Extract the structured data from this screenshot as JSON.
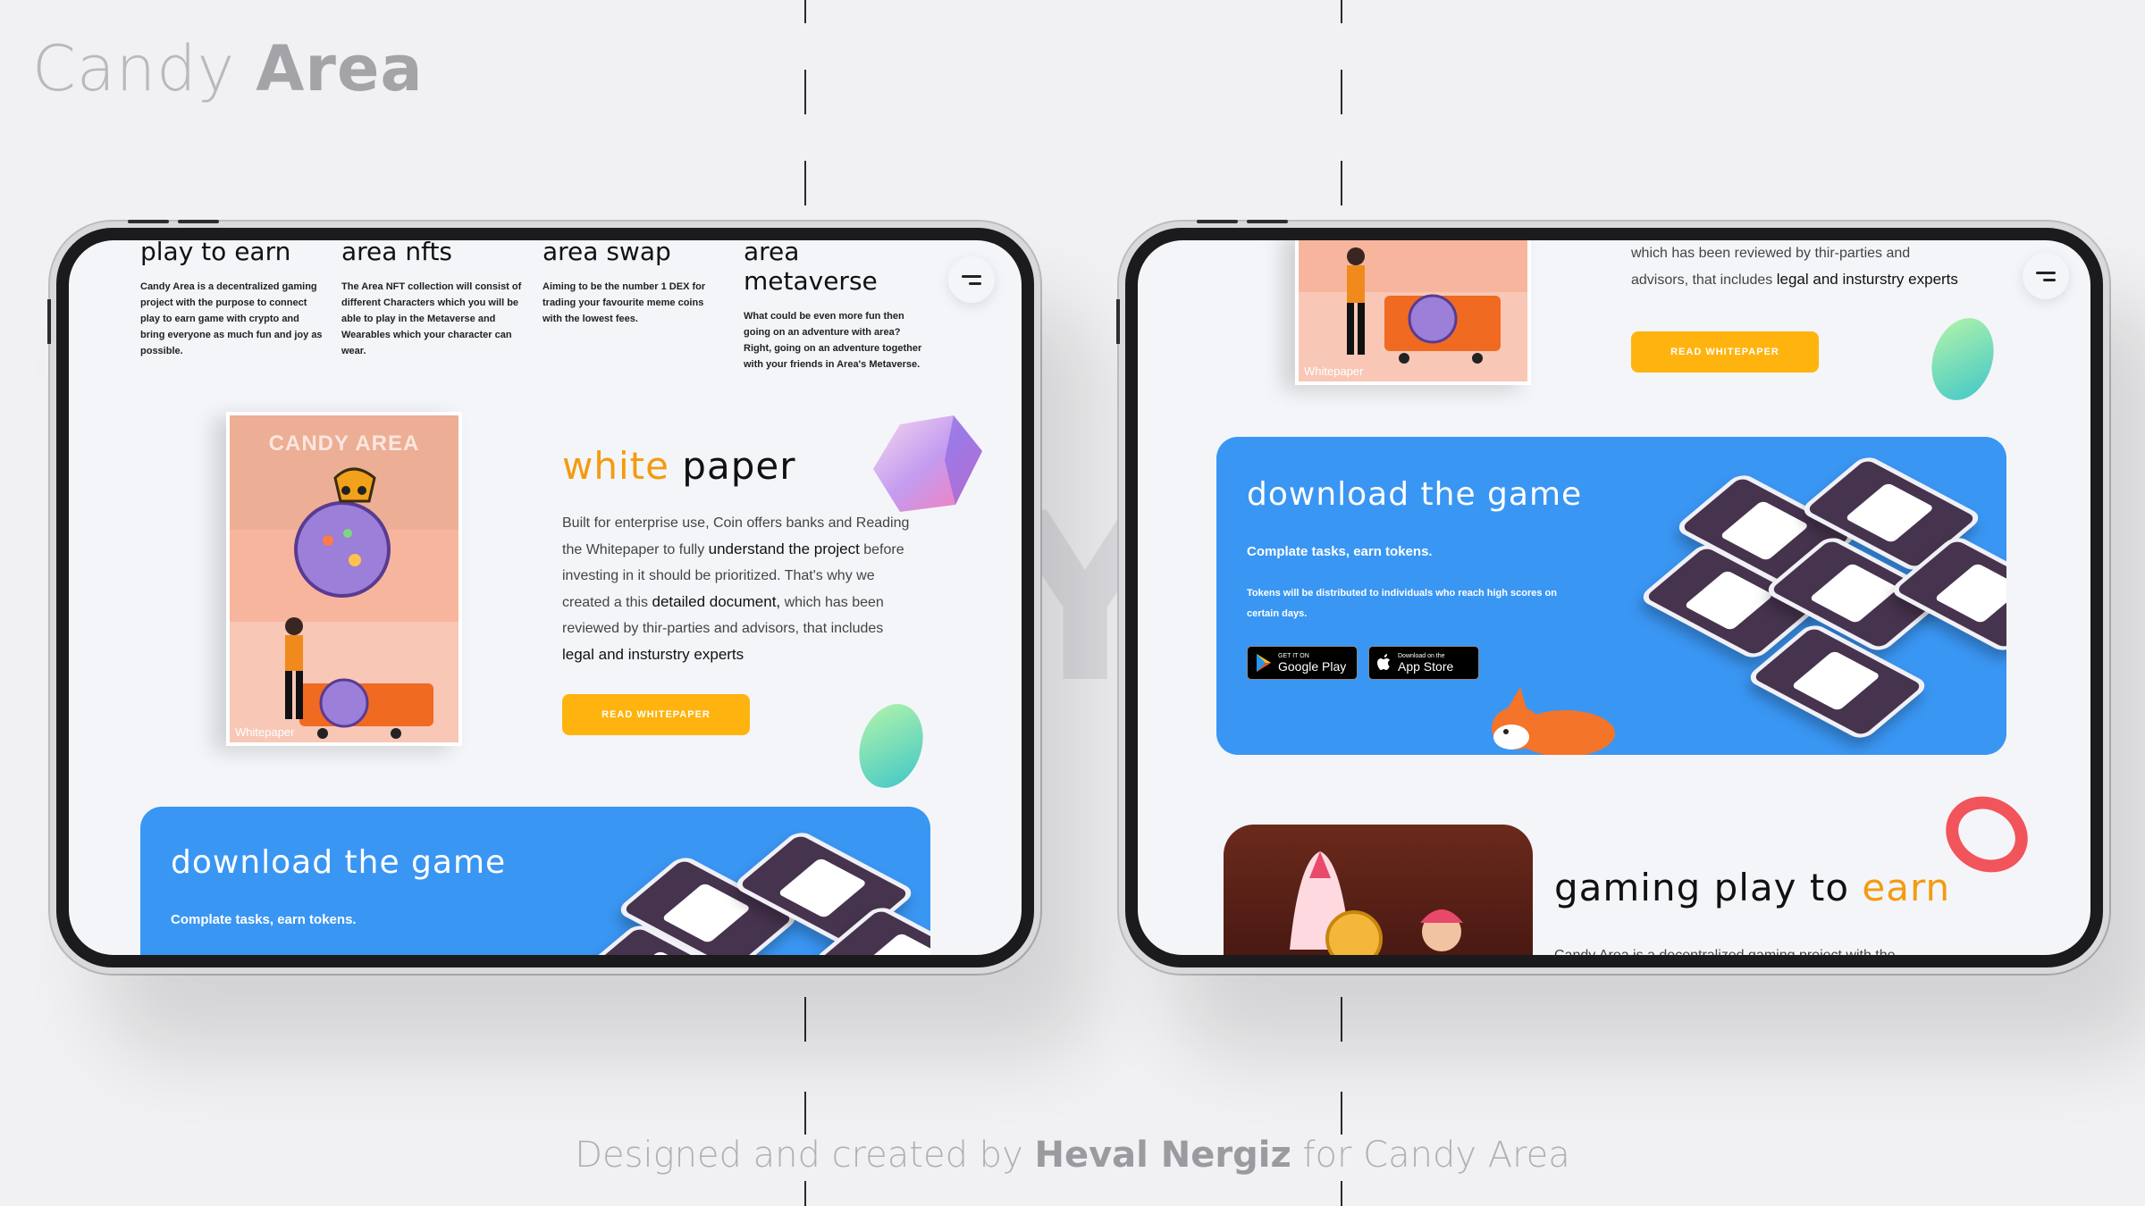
{
  "brand": {
    "light": "Candy ",
    "bold": "Area"
  },
  "credit": {
    "prefix": "Designed and created by ",
    "author": "Heval Nergiz",
    "suffix": " for Candy Area"
  },
  "left": {
    "features": [
      {
        "title": "play to earn",
        "text": "Candy Area is a decentralized gaming project with the purpose to connect play to earn game with crypto and bring everyone as much fun and joy as possible."
      },
      {
        "title": "area nfts",
        "text": "The Area NFT collection will consist of different Characters which you will be able to play in the Metaverse and Wearables which your character can wear."
      },
      {
        "title": "area swap",
        "text": "Aiming to be the number 1 DEX for trading your favourite meme coins with the lowest fees."
      },
      {
        "title": "area metaverse",
        "text": "What could be even more fun then going on an adventure with area? Right, going on an adventure together with your friends in Area's Metaverse."
      }
    ],
    "whitepaper": {
      "card_title": "CANDY AREA",
      "card_caption": "Whitepaper",
      "title_accent": "white",
      "title_rest": " paper",
      "p1": "Built for enterprise use, Coin offers banks and Reading the Whitepaper to fully ",
      "b1": "understand the project",
      "p2": " before investing in it should be prioritized. That's why we created a this ",
      "b2": "detailed document,",
      "p3": " which has been reviewed by thir-parties and advisors, that includes ",
      "b3": "legal and insturstry experts",
      "button": "READ WHITEPAPER"
    },
    "download": {
      "title": "download the game",
      "subtitle": "Complate tasks, earn tokens."
    }
  },
  "right": {
    "whitepaper": {
      "card_caption": "Whitepaper",
      "p1": "which has been reviewed by thir-parties and advisors, that includes ",
      "b1": "legal and insturstry experts",
      "button": "READ WHITEPAPER"
    },
    "download": {
      "title": "download the game",
      "subtitle": "Complate tasks, earn tokens.",
      "small": "Tokens will be distributed to individuals who reach high scores on certain days.",
      "google_small": "GET IT ON",
      "google_big": "Google Play",
      "apple_small": "Download on the",
      "apple_big": "App Store"
    },
    "gaming": {
      "t1": "gaming play to ",
      "t2": "earn",
      "text": "Candy Area is a decentralized gaming project with the"
    }
  },
  "colors": {
    "accent": "#ffb30f",
    "orange": "#f39b10",
    "banner": "#3a96f3"
  }
}
